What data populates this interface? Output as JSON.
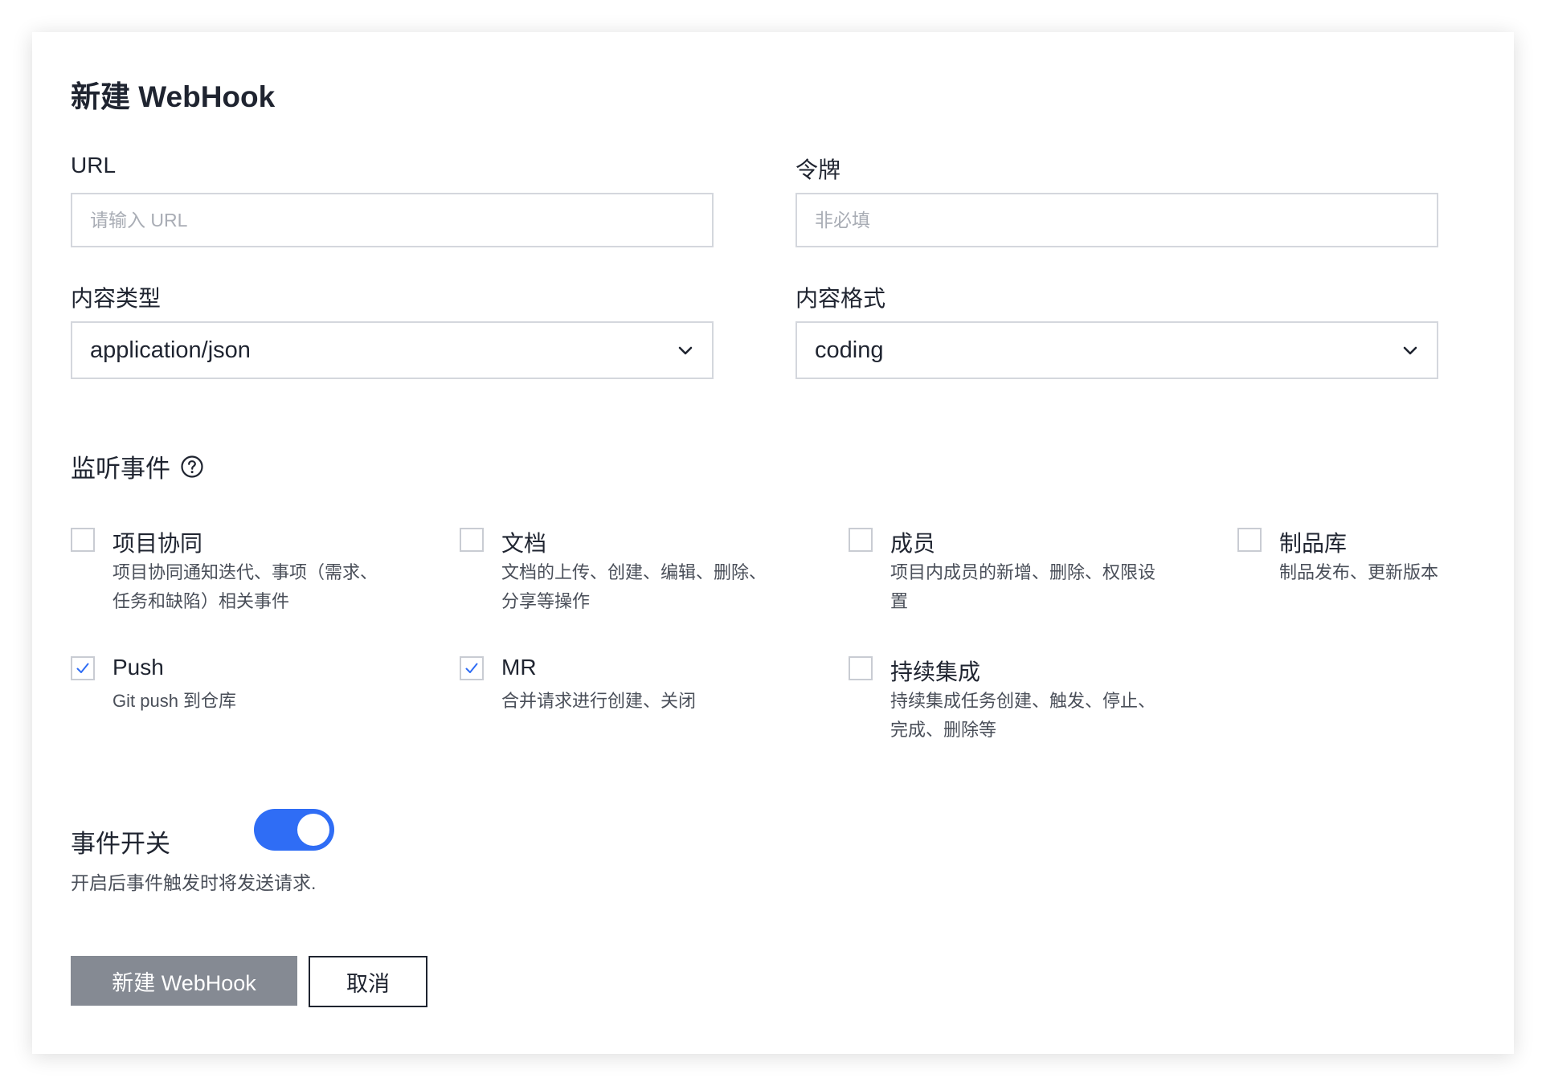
{
  "dialog": {
    "title": "新建 WebHook"
  },
  "form": {
    "url": {
      "label": "URL",
      "placeholder": "请输入 URL",
      "value": ""
    },
    "token": {
      "label": "令牌",
      "placeholder": "非必填",
      "value": ""
    },
    "content_type": {
      "label": "内容类型",
      "value": "application/json"
    },
    "content_format": {
      "label": "内容格式",
      "value": "coding"
    }
  },
  "events": {
    "title": "监听事件",
    "help_icon": "question-circle-icon",
    "items": [
      {
        "title": "项目协同",
        "desc": "项目协同通知迭代、事项（需求、任务和缺陷）相关事件",
        "checked": false
      },
      {
        "title": "文档",
        "desc": "文档的上传、创建、编辑、删除、分享等操作",
        "checked": false
      },
      {
        "title": "成员",
        "desc": "项目内成员的新增、删除、权限设置",
        "checked": false
      },
      {
        "title": "制品库",
        "desc": "制品发布、更新版本",
        "checked": false
      },
      {
        "title": "Push",
        "desc": "Git push 到仓库",
        "checked": true
      },
      {
        "title": "MR",
        "desc": "合并请求进行创建、关闭",
        "checked": true
      },
      {
        "title": "持续集成",
        "desc": "持续集成任务创建、触发、停止、完成、删除等",
        "checked": false
      }
    ]
  },
  "switch": {
    "label": "事件开关",
    "on": true,
    "hint": "开启后事件触发时将发送请求."
  },
  "actions": {
    "submit_label": "新建 WebHook",
    "cancel_label": "取消"
  },
  "colors": {
    "accent": "#2f6df5",
    "primary_button": "#858a93",
    "check": "#2f6df5"
  }
}
